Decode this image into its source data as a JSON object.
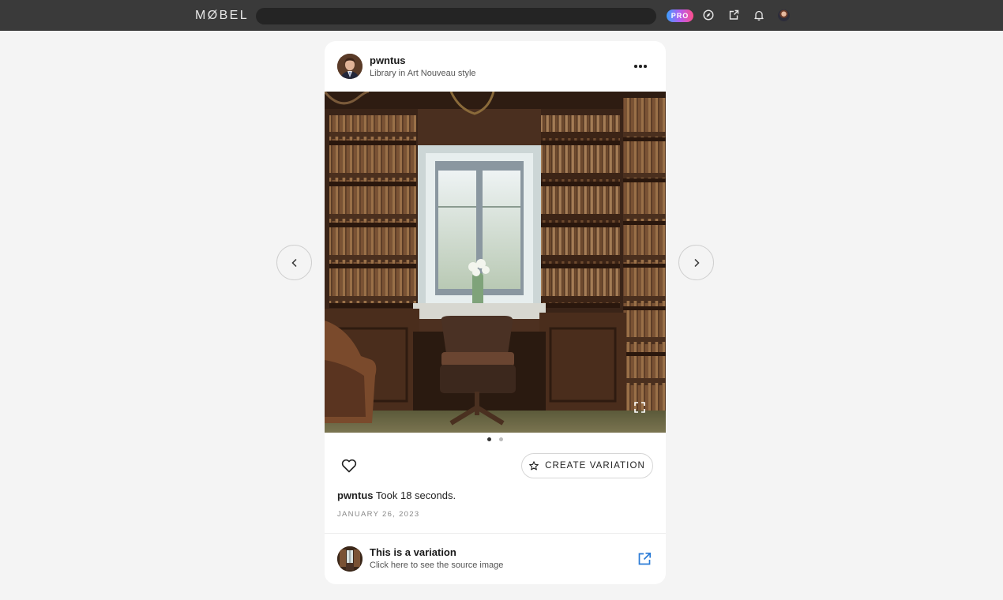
{
  "topbar": {
    "logo": "MØBEL",
    "search_value": "",
    "pro_badge": "PRO",
    "icons": [
      "compass-icon",
      "share-icon",
      "bell-icon",
      "user-avatar"
    ]
  },
  "post": {
    "username": "pwntus",
    "subtitle": "Library in Art Nouveau style",
    "image_description_icon": "library-image",
    "carousel_index": 1,
    "carousel_count": 2,
    "create_variation_label": "CREATE VARIATION",
    "caption_user": "pwntus",
    "caption_text": "Took 18 seconds.",
    "date": "JANUARY 26, 2023"
  },
  "source": {
    "title": "This is a variation",
    "subtitle": "Click here to see the source image"
  },
  "colors": {
    "topbar_bg": "#3a3a3a",
    "page_bg": "#f4f4f4",
    "link_blue": "#2a7bd6"
  }
}
